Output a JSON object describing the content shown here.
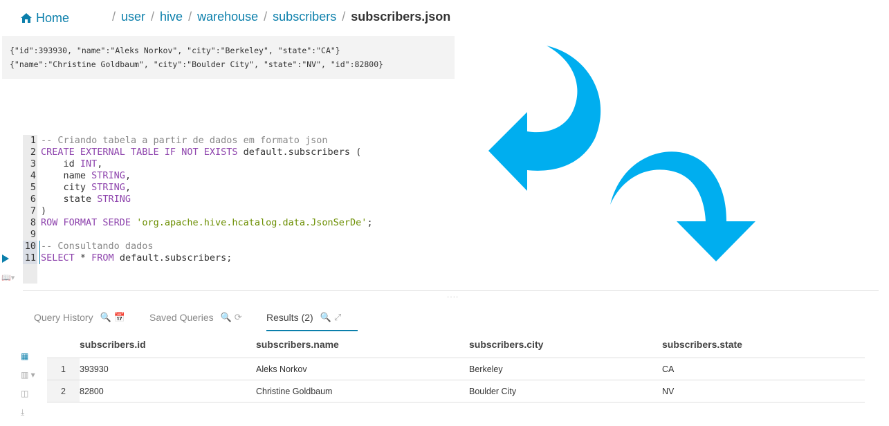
{
  "breadcrumb": {
    "home_label": "Home",
    "home_icon": "home-icon",
    "separator": "/",
    "parts": [
      "user",
      "hive",
      "warehouse",
      "subscribers"
    ],
    "current": "subscribers.json"
  },
  "preview": {
    "lines": [
      "{\"id\":393930, \"name\":\"Aleks Norkov\", \"city\":\"Berkeley\", \"state\":\"CA\"}",
      "{\"name\":\"Christine Goldbaum\", \"city\":\"Boulder City\", \"state\":\"NV\", \"id\":82800}"
    ]
  },
  "editor": {
    "line_numbers": [
      "1",
      "2",
      "3",
      "4",
      "5",
      "6",
      "7",
      "8",
      "9",
      "10",
      "11"
    ],
    "active_lines": [
      "10",
      "11"
    ],
    "lines": [
      [
        {
          "t": "cm",
          "v": "-- Criando tabela a partir de dados em formato json"
        }
      ],
      [
        {
          "t": "kw",
          "v": "CREATE EXTERNAL TABLE IF NOT EXISTS"
        },
        {
          "t": "",
          "v": " default.subscribers ("
        }
      ],
      [
        {
          "t": "",
          "v": "    id "
        },
        {
          "t": "kw",
          "v": "INT"
        },
        {
          "t": "",
          "v": ","
        }
      ],
      [
        {
          "t": "",
          "v": "    name "
        },
        {
          "t": "kw",
          "v": "STRING"
        },
        {
          "t": "",
          "v": ","
        }
      ],
      [
        {
          "t": "",
          "v": "    city "
        },
        {
          "t": "kw",
          "v": "STRING"
        },
        {
          "t": "",
          "v": ","
        }
      ],
      [
        {
          "t": "",
          "v": "    state "
        },
        {
          "t": "kw",
          "v": "STRING"
        }
      ],
      [
        {
          "t": "",
          "v": ")"
        }
      ],
      [
        {
          "t": "kw",
          "v": "ROW FORMAT SERDE"
        },
        {
          "t": "",
          "v": " "
        },
        {
          "t": "str",
          "v": "'org.apache.hive.hcatalog.data.JsonSerDe'"
        },
        {
          "t": "",
          "v": ";"
        }
      ],
      [
        {
          "t": "",
          "v": ""
        }
      ],
      [
        {
          "t": "cm",
          "v": "-- Consultando dados"
        }
      ],
      [
        {
          "t": "kw",
          "v": "SELECT"
        },
        {
          "t": "",
          "v": " * "
        },
        {
          "t": "kw",
          "v": "FROM"
        },
        {
          "t": "",
          "v": " default.subscribers;"
        }
      ]
    ]
  },
  "tabs": [
    {
      "label": "Query History",
      "icons": [
        "search-icon",
        "clear-calendar-icon"
      ]
    },
    {
      "label": "Saved Queries",
      "icons": [
        "search-icon",
        "refresh-icon"
      ]
    },
    {
      "label": "Results (2)",
      "icons": [
        "search-icon",
        "expand-icon"
      ],
      "active": true
    }
  ],
  "results": {
    "columns": [
      "subscribers.id",
      "subscribers.name",
      "subscribers.city",
      "subscribers.state"
    ],
    "rows": [
      {
        "num": "1",
        "cells": [
          "393930",
          "Aleks Norkov",
          "Berkeley",
          "CA"
        ]
      },
      {
        "num": "2",
        "cells": [
          "82800",
          "Christine Goldbaum",
          "Boulder City",
          "NV"
        ]
      }
    ]
  },
  "colors": {
    "accent": "#0b7fab",
    "arrow": "#00aeef",
    "keyword": "#8e44ad",
    "string": "#6b8e00",
    "comment": "#888888"
  }
}
